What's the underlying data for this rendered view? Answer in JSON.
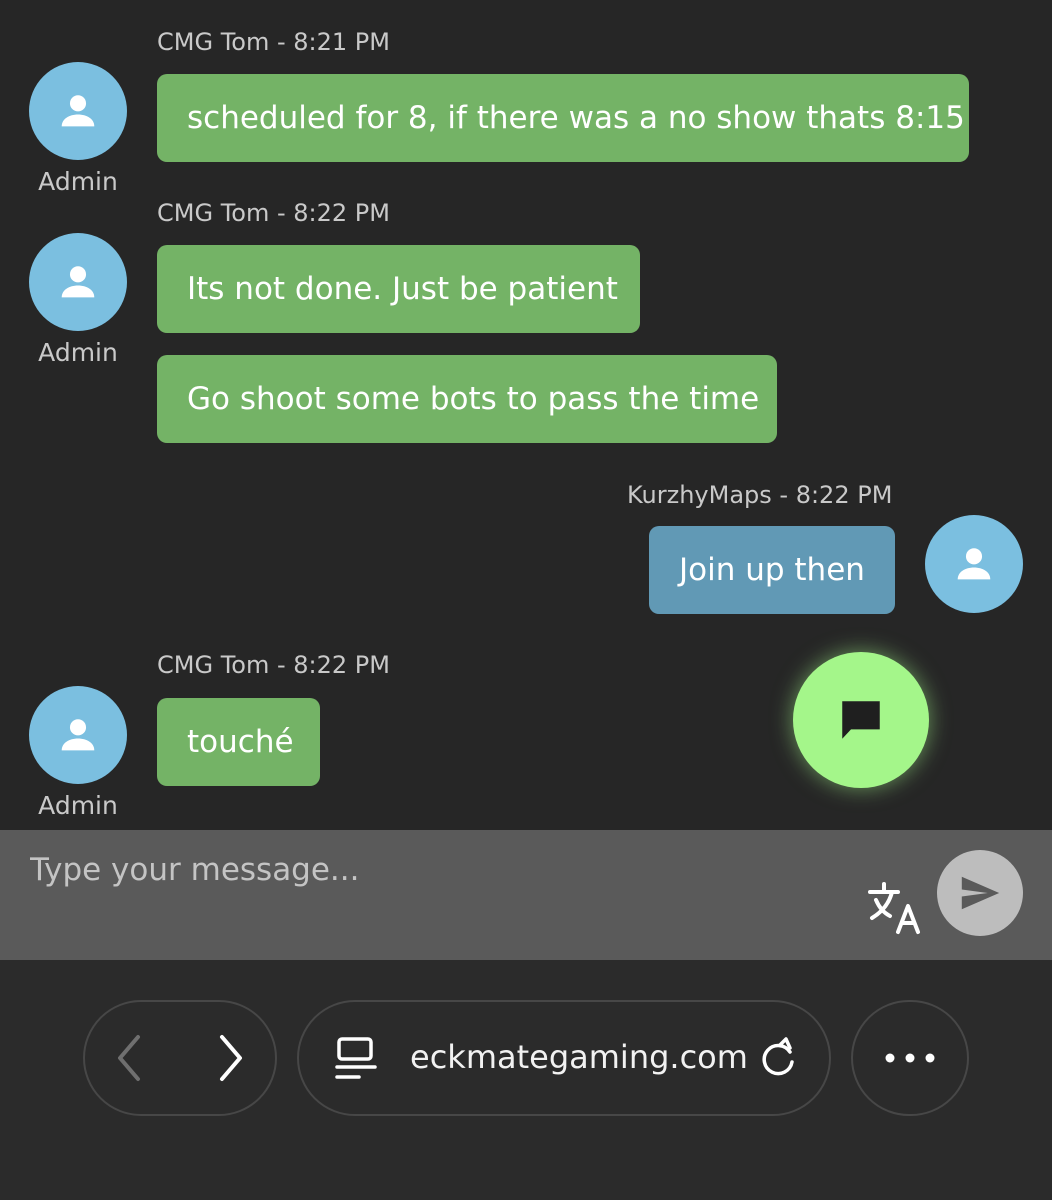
{
  "messages": [
    {
      "meta": "CMG Tom - 8:21 PM",
      "role": "Admin",
      "bubbles": [
        "scheduled for 8, if there was a no show thats 8:15"
      ]
    },
    {
      "meta": "CMG Tom - 8:22 PM",
      "role": "Admin",
      "bubbles": [
        "Its not done. Just be patient",
        "Go shoot some bots to pass the time"
      ]
    },
    {
      "meta": "KurzhyMaps - 8:22 PM",
      "bubbles": [
        "Join up then"
      ]
    },
    {
      "meta": "CMG Tom - 8:22 PM",
      "role": "Admin",
      "bubbles": [
        "touché"
      ]
    }
  ],
  "composer": {
    "placeholder": "Type your message..."
  },
  "browser": {
    "url": "eckmategaming.com"
  },
  "icons": {
    "avatar": "person-icon",
    "fab": "chat-bubble-icon",
    "translate": "translate-icon",
    "send": "send-icon",
    "back": "chevron-left-icon",
    "forward": "chevron-right-icon",
    "page": "page-menu-icon",
    "reload": "reload-icon",
    "more": "more-icon"
  },
  "colors": {
    "background": "#262626",
    "incoming_bubble": "#74b366",
    "outgoing_bubble": "#6199b5",
    "avatar": "#7bbfe0",
    "fab": "#a4f68a",
    "composer": "#5a5a5a"
  }
}
